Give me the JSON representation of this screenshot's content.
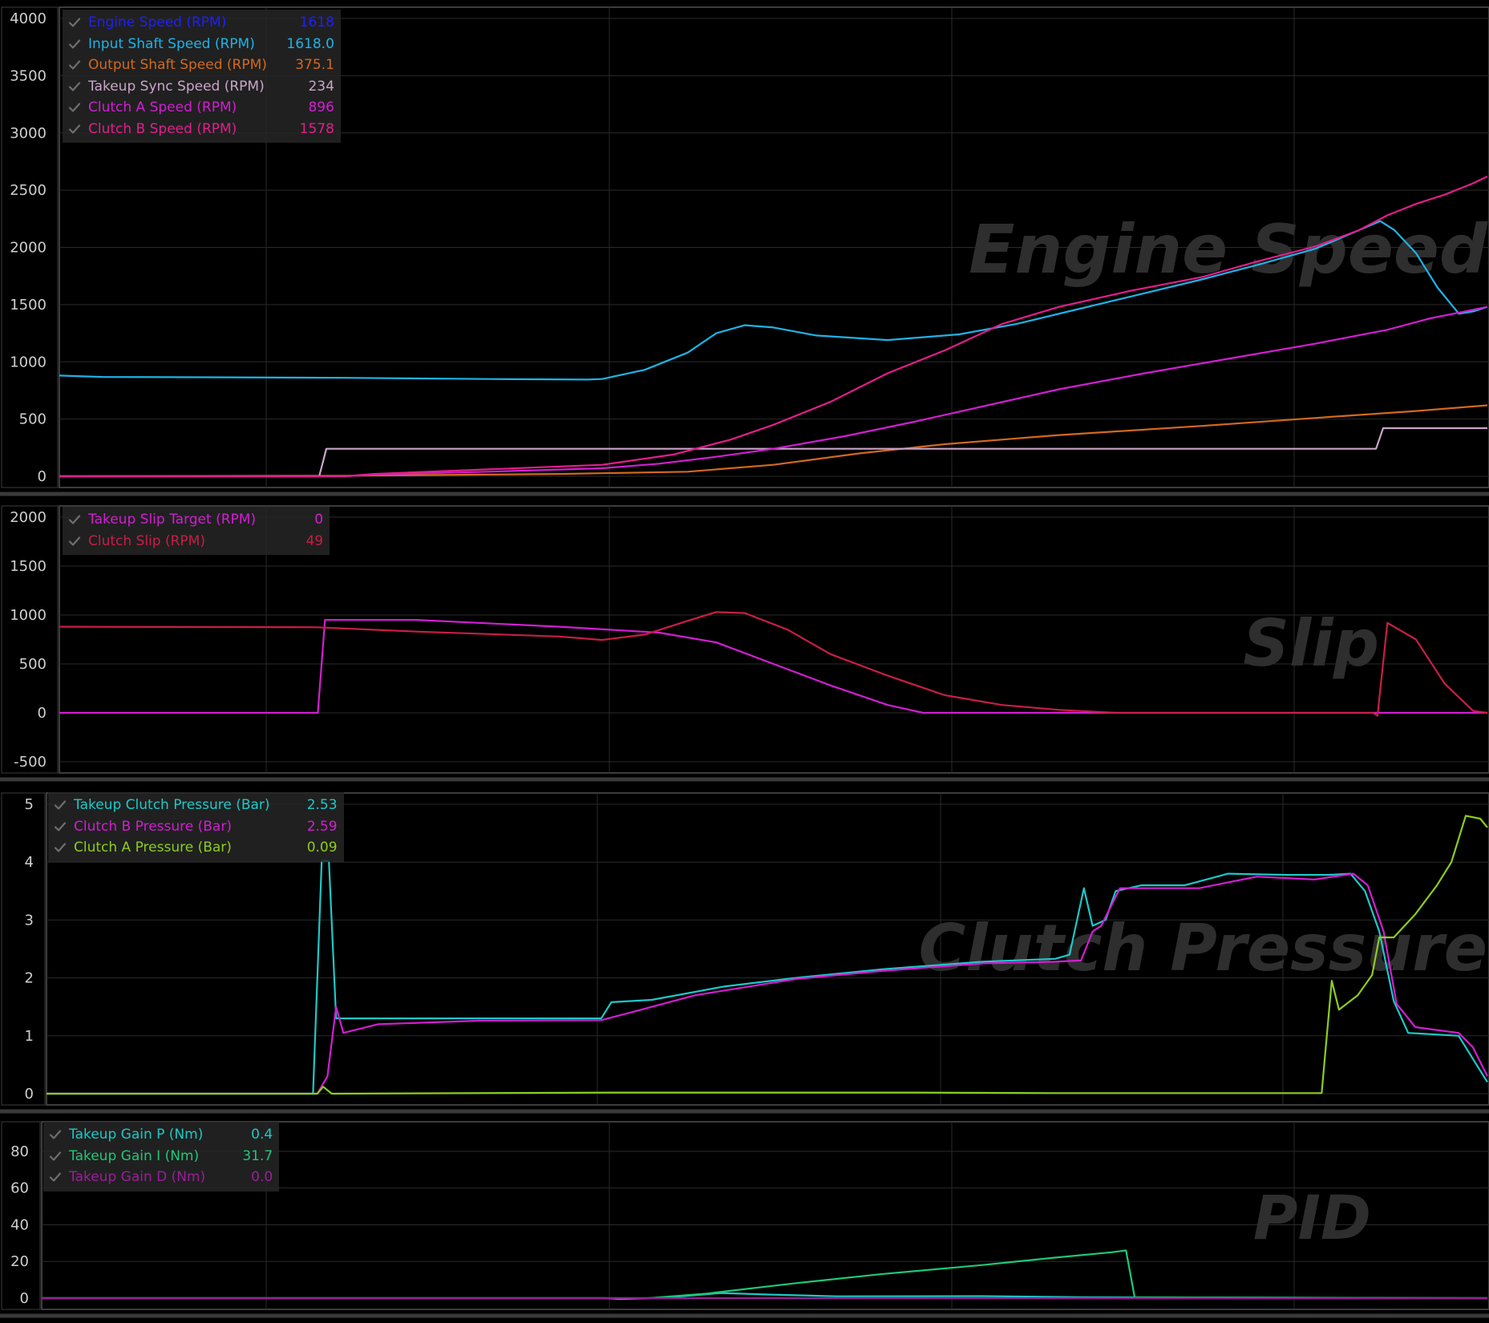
{
  "colors": {
    "background": "#000000",
    "grid": "#2a2a2a",
    "axis_text": "#cfcfcf",
    "watermark": "#2e2e2e",
    "engine_speed": "#1f1fff",
    "input_shaft_speed": "#1eb3e6",
    "output_shaft_speed": "#d2691e",
    "takeup_sync_speed": "#c9a5c9",
    "clutch_a_speed": "#d21ed2",
    "clutch_b_speed": "#e21e8c",
    "takeup_slip_target": "#d21ed2",
    "clutch_slip": "#c81e46",
    "takeup_clutch_pressure": "#1ec8c8",
    "clutch_b_pressure": "#d21ed2",
    "clutch_a_pressure": "#8ccd1e",
    "takeup_gain_p": "#1ec8c8",
    "takeup_gain_i": "#1ec878",
    "takeup_gain_d": "#9b1e9b"
  },
  "icons": {
    "check": "check-icon"
  },
  "chart_data": [
    {
      "type": "line",
      "title": "Engine Speed",
      "ylim": [
        0,
        4000
      ],
      "yticks": [
        0,
        500,
        1000,
        1500,
        2000,
        2500,
        3000,
        3500,
        4000
      ],
      "xlim": [
        0,
        100
      ],
      "grid": true,
      "legend": "top-left",
      "series": [
        {
          "name": "Engine Speed (RPM)",
          "value": "1618",
          "color": "#1f1fff",
          "points": []
        },
        {
          "name": "Input Shaft Speed (RPM)",
          "value": "1618.0",
          "color": "#1eb3e6",
          "points": [
            [
              0,
              880
            ],
            [
              3,
              868
            ],
            [
              10,
              865
            ],
            [
              20,
              860
            ],
            [
              30,
              850
            ],
            [
              37,
              845
            ],
            [
              38,
              850
            ],
            [
              41,
              930
            ],
            [
              44,
              1080
            ],
            [
              46,
              1250
            ],
            [
              48,
              1320
            ],
            [
              50,
              1300
            ],
            [
              53,
              1230
            ],
            [
              58,
              1190
            ],
            [
              63,
              1240
            ],
            [
              67,
              1330
            ],
            [
              71,
              1450
            ],
            [
              75,
              1570
            ],
            [
              80,
              1720
            ],
            [
              84,
              1850
            ],
            [
              88,
              1990
            ],
            [
              91,
              2150
            ],
            [
              92.5,
              2230
            ],
            [
              93.5,
              2150
            ],
            [
              95,
              1950
            ],
            [
              96.5,
              1650
            ],
            [
              98,
              1420
            ],
            [
              99,
              1440
            ],
            [
              100,
              1480
            ]
          ]
        },
        {
          "name": "Output Shaft Speed (RPM)",
          "value": "375.1",
          "color": "#d2691e",
          "points": [
            [
              0,
              0
            ],
            [
              20,
              5
            ],
            [
              35,
              20
            ],
            [
              44,
              40
            ],
            [
              50,
              100
            ],
            [
              56,
              200
            ],
            [
              62,
              280
            ],
            [
              70,
              360
            ],
            [
              80,
              440
            ],
            [
              88,
              510
            ],
            [
              95,
              570
            ],
            [
              100,
              620
            ]
          ]
        },
        {
          "name": "Takeup Sync Speed (RPM)",
          "value": "234",
          "color": "#c9a5c9",
          "points": [
            [
              0,
              0
            ],
            [
              18.2,
              0
            ],
            [
              18.7,
              240
            ],
            [
              92.2,
              240
            ],
            [
              92.7,
              420
            ],
            [
              100,
              420
            ]
          ]
        },
        {
          "name": "Clutch A Speed (RPM)",
          "value": "896",
          "color": "#d21ed2",
          "points": [
            [
              0,
              0
            ],
            [
              20,
              0
            ],
            [
              22,
              15
            ],
            [
              30,
              40
            ],
            [
              38,
              70
            ],
            [
              42,
              110
            ],
            [
              46,
              170
            ],
            [
              50,
              240
            ],
            [
              55,
              350
            ],
            [
              60,
              480
            ],
            [
              65,
              620
            ],
            [
              70,
              760
            ],
            [
              76,
              900
            ],
            [
              82,
              1030
            ],
            [
              88,
              1160
            ],
            [
              93,
              1280
            ],
            [
              96,
              1380
            ],
            [
              98,
              1430
            ],
            [
              100,
              1480
            ]
          ]
        },
        {
          "name": "Clutch B Speed (RPM)",
          "value": "1578",
          "color": "#e21e8c",
          "points": [
            [
              0,
              0
            ],
            [
              20,
              0
            ],
            [
              22,
              20
            ],
            [
              30,
              60
            ],
            [
              38,
              100
            ],
            [
              43,
              190
            ],
            [
              47,
              320
            ],
            [
              50,
              450
            ],
            [
              54,
              650
            ],
            [
              58,
              900
            ],
            [
              62,
              1100
            ],
            [
              66,
              1330
            ],
            [
              70,
              1480
            ],
            [
              75,
              1620
            ],
            [
              80,
              1740
            ],
            [
              84,
              1880
            ],
            [
              88,
              2010
            ],
            [
              91,
              2150
            ],
            [
              93,
              2280
            ],
            [
              95,
              2380
            ],
            [
              97,
              2460
            ],
            [
              99,
              2560
            ],
            [
              100,
              2620
            ]
          ]
        }
      ]
    },
    {
      "type": "line",
      "title": "Slip",
      "ylim": [
        -500,
        2000
      ],
      "yticks": [
        -500,
        0,
        500,
        1000,
        1500,
        2000
      ],
      "xlim": [
        0,
        100
      ],
      "grid": true,
      "legend": "top-left",
      "series": [
        {
          "name": "Takeup Slip Target (RPM)",
          "value": "0",
          "color": "#d21ed2",
          "points": [
            [
              0,
              0
            ],
            [
              18.1,
              0
            ],
            [
              18.6,
              950
            ],
            [
              25,
              950
            ],
            [
              35,
              880
            ],
            [
              42,
              820
            ],
            [
              46,
              720
            ],
            [
              50,
              500
            ],
            [
              54,
              280
            ],
            [
              58,
              80
            ],
            [
              60.5,
              0
            ],
            [
              100,
              0
            ]
          ]
        },
        {
          "name": "Clutch Slip (RPM)",
          "value": "49",
          "color": "#c81e46",
          "points": [
            [
              0,
              880
            ],
            [
              18,
              875
            ],
            [
              25,
              830
            ],
            [
              35,
              780
            ],
            [
              38,
              745
            ],
            [
              41,
              800
            ],
            [
              44,
              940
            ],
            [
              46,
              1030
            ],
            [
              48,
              1020
            ],
            [
              51,
              850
            ],
            [
              54,
              600
            ],
            [
              58,
              380
            ],
            [
              62,
              180
            ],
            [
              66,
              80
            ],
            [
              70,
              30
            ],
            [
              74,
              0
            ],
            [
              92,
              0
            ],
            [
              92.3,
              -30
            ],
            [
              93,
              920
            ],
            [
              95,
              750
            ],
            [
              97,
              300
            ],
            [
              99,
              20
            ],
            [
              100,
              0
            ]
          ]
        }
      ]
    },
    {
      "type": "line",
      "title": "Clutch Pressure",
      "ylim": [
        0,
        5
      ],
      "yticks": [
        0,
        1,
        2,
        3,
        4,
        5
      ],
      "xlim": [
        0,
        100
      ],
      "grid": true,
      "legend": "top-left",
      "series": [
        {
          "name": "Takeup Clutch Pressure (Bar)",
          "value": "2.53",
          "color": "#1ec8c8",
          "points": [
            [
              0,
              0
            ],
            [
              18.5,
              0
            ],
            [
              19.1,
              4.02
            ],
            [
              19.6,
              4.02
            ],
            [
              20.1,
              1.3
            ],
            [
              25,
              1.3
            ],
            [
              32,
              1.3
            ],
            [
              38.5,
              1.3
            ],
            [
              39.2,
              1.58
            ],
            [
              42,
              1.62
            ],
            [
              47,
              1.85
            ],
            [
              52,
              2.0
            ],
            [
              58,
              2.15
            ],
            [
              65,
              2.28
            ],
            [
              70,
              2.33
            ],
            [
              71,
              2.4
            ],
            [
              72,
              3.55
            ],
            [
              72.6,
              2.9
            ],
            [
              73.5,
              3.0
            ],
            [
              74.2,
              3.5
            ],
            [
              76,
              3.6
            ],
            [
              79,
              3.6
            ],
            [
              82,
              3.8
            ],
            [
              86,
              3.78
            ],
            [
              89,
              3.78
            ],
            [
              90.5,
              3.8
            ],
            [
              91.5,
              3.5
            ],
            [
              92.5,
              2.8
            ],
            [
              93.5,
              1.6
            ],
            [
              94.5,
              1.05
            ],
            [
              98,
              1.0
            ],
            [
              99,
              0.6
            ],
            [
              100,
              0.2
            ]
          ]
        },
        {
          "name": "Clutch B Pressure (Bar)",
          "value": "2.59",
          "color": "#d21ed2",
          "points": [
            [
              0,
              0
            ],
            [
              18.8,
              0
            ],
            [
              19.5,
              0.3
            ],
            [
              20.1,
              1.5
            ],
            [
              20.6,
              1.05
            ],
            [
              23,
              1.2
            ],
            [
              30,
              1.26
            ],
            [
              38.5,
              1.27
            ],
            [
              40.5,
              1.4
            ],
            [
              45,
              1.7
            ],
            [
              52,
              1.98
            ],
            [
              58,
              2.12
            ],
            [
              65,
              2.25
            ],
            [
              70,
              2.28
            ],
            [
              71.8,
              2.3
            ],
            [
              72.6,
              2.8
            ],
            [
              73.2,
              2.9
            ],
            [
              74.5,
              3.55
            ],
            [
              80,
              3.55
            ],
            [
              84,
              3.75
            ],
            [
              88,
              3.7
            ],
            [
              90.7,
              3.8
            ],
            [
              91.7,
              3.6
            ],
            [
              92.8,
              2.8
            ],
            [
              93.7,
              1.55
            ],
            [
              95,
              1.15
            ],
            [
              98,
              1.05
            ],
            [
              99,
              0.8
            ],
            [
              100,
              0.3
            ]
          ]
        },
        {
          "name": "Clutch A Pressure (Bar)",
          "value": "0.09",
          "color": "#8ccd1e",
          "points": [
            [
              0,
              0
            ],
            [
              18.8,
              0
            ],
            [
              19.2,
              0.12
            ],
            [
              19.8,
              0
            ],
            [
              40,
              0.02
            ],
            [
              60,
              0.02
            ],
            [
              70,
              0.01
            ],
            [
              88.5,
              0.01
            ],
            [
              89.2,
              1.95
            ],
            [
              89.7,
              1.45
            ],
            [
              91,
              1.7
            ],
            [
              92,
              2.05
            ],
            [
              92.5,
              2.7
            ],
            [
              93.5,
              2.7
            ],
            [
              95,
              3.1
            ],
            [
              96.5,
              3.6
            ],
            [
              97.5,
              4.0
            ],
            [
              98.5,
              4.8
            ],
            [
              99.5,
              4.75
            ],
            [
              100,
              4.6
            ]
          ]
        }
      ]
    },
    {
      "type": "line",
      "title": "PID",
      "ylim": [
        0,
        90
      ],
      "yticks": [
        0,
        20,
        40,
        60,
        80
      ],
      "xlim": [
        0,
        100
      ],
      "grid": true,
      "legend": "top-left",
      "series": [
        {
          "name": "Takeup Gain P (Nm)",
          "value": "0.4",
          "color": "#1ec8c8",
          "points": [
            [
              0,
              0
            ],
            [
              39,
              0
            ],
            [
              40,
              -0.5
            ],
            [
              43,
              0.2
            ],
            [
              47,
              2.8
            ],
            [
              50,
              2
            ],
            [
              55,
              1
            ],
            [
              65,
              1.1
            ],
            [
              72,
              0.5
            ],
            [
              100,
              0
            ]
          ]
        },
        {
          "name": "Takeup Gain I (Nm)",
          "value": "31.7",
          "color": "#1ec878",
          "points": [
            [
              0,
              0
            ],
            [
              39,
              0
            ],
            [
              42,
              0
            ],
            [
              46,
              2.5
            ],
            [
              52,
              8
            ],
            [
              58,
              13
            ],
            [
              65,
              18
            ],
            [
              70,
              22
            ],
            [
              74,
              25
            ],
            [
              75,
              26
            ],
            [
              75.6,
              0.5
            ],
            [
              100,
              0
            ]
          ]
        },
        {
          "name": "Takeup Gain D (Nm)",
          "value": "0.0",
          "color": "#9b1e9b",
          "points": [
            [
              0,
              0
            ],
            [
              100,
              0
            ]
          ]
        }
      ]
    }
  ]
}
